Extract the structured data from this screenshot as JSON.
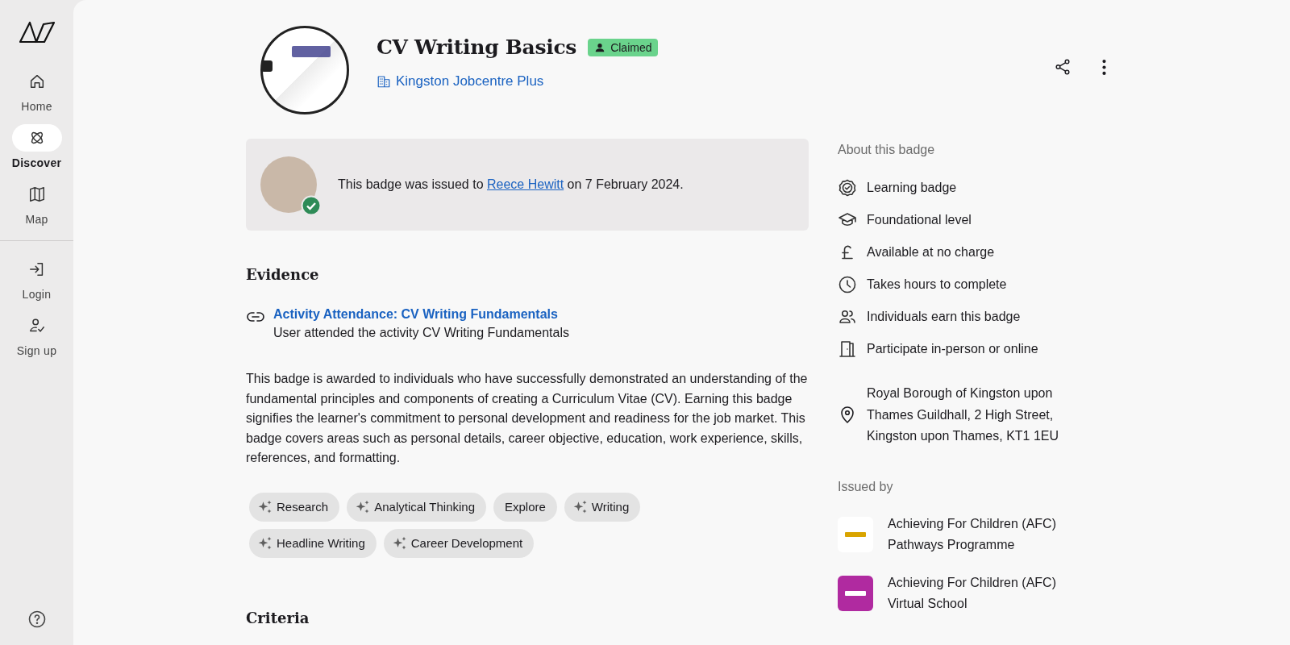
{
  "sidebar": {
    "items": [
      {
        "label": "Home",
        "selected": false
      },
      {
        "label": "Discover",
        "selected": true
      },
      {
        "label": "Map",
        "selected": false
      },
      {
        "label": "Login",
        "selected": false
      },
      {
        "label": "Sign up",
        "selected": false
      }
    ]
  },
  "badge": {
    "title": "CV Writing Basics",
    "status": "Claimed",
    "issuer_link": "Kingston Jobcentre Plus"
  },
  "notice": {
    "before": "This badge was issued to",
    "recipient": "Reece Hewitt",
    "after": "on 7 February 2024.",
    "verified": true
  },
  "evidence": {
    "heading": "Evidence",
    "items": [
      {
        "title": "Activity Attendance: CV Writing Fundamentals",
        "description": "User attended the activity CV Writing Fundamentals"
      }
    ],
    "description": "This badge is awarded to individuals who have successfully demonstrated an understanding of the fundamental principles and components of creating a Curriculum Vitae (CV). Earning this badge signifies the learner's commitment to personal development and readiness for the job market. This badge covers areas such as personal details, career objective, education, work experience, skills, references, and formatting.",
    "skills": [
      {
        "label": "Research",
        "kind": "suggested"
      },
      {
        "label": "Analytical Thinking",
        "kind": "suggested"
      },
      {
        "label": "Explore",
        "kind": "plain"
      },
      {
        "label": "Writing",
        "kind": "suggested"
      },
      {
        "label": "Headline Writing",
        "kind": "suggested"
      },
      {
        "label": "Career Development",
        "kind": "suggested"
      }
    ]
  },
  "criteria": {
    "heading": "Criteria"
  },
  "about": {
    "heading": "About this badge",
    "items": [
      "Learning badge",
      "Foundational level",
      "Available at no charge",
      "Takes hours to complete",
      "Individuals earn this badge",
      "Participate in-person or online"
    ],
    "address": "Royal Borough of Kingston upon Thames Guildhall, 2 High Street, Kingston upon Thames, KT1 1EU"
  },
  "issued_by": {
    "heading": "Issued by",
    "issuers": [
      {
        "name": "Achieving For Children (AFC) Pathways Programme"
      },
      {
        "name": "Achieving For Children (AFC) Virtual School"
      }
    ]
  }
}
